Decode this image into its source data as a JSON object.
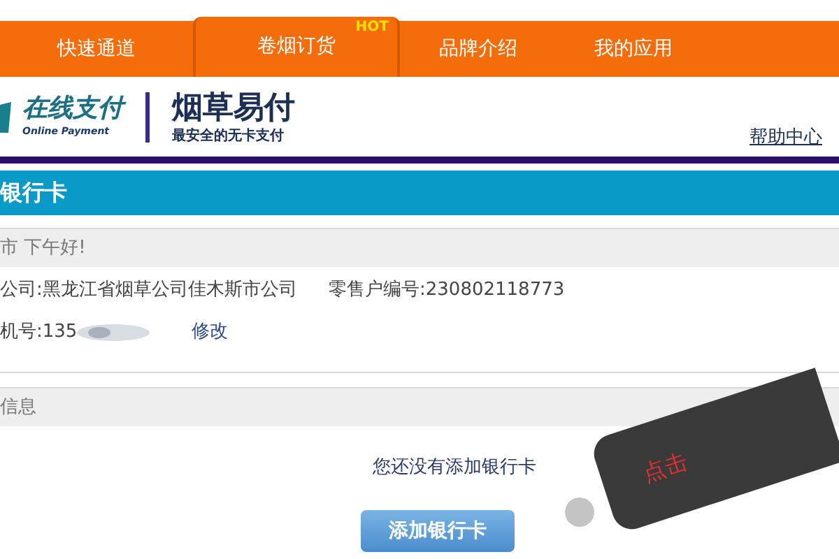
{
  "nav": [
    {
      "label": "快速通道",
      "selected": false
    },
    {
      "label": "卷烟订货",
      "selected": true,
      "badge": "HOT"
    },
    {
      "label": "品牌介绍",
      "selected": false
    },
    {
      "label": "我的应用",
      "selected": false
    }
  ],
  "logo": {
    "name": "在线支付",
    "subname": "Online Payment",
    "title": "烟草易付",
    "slogan": "最安全的无卡支付"
  },
  "help_link": "帮助中心",
  "section_title": "银行卡",
  "greeting": "市 下午好!",
  "info": {
    "company": "公司:黑龙江省烟草公司佳木斯市公司",
    "retailer_id": "零售户编号:230802118773",
    "phone": "机号:135",
    "edit_link": "修改"
  },
  "card_section": "信息",
  "empty_message": "您还没有添加银行卡",
  "add_button": "添加银行卡",
  "annotation": "点击"
}
